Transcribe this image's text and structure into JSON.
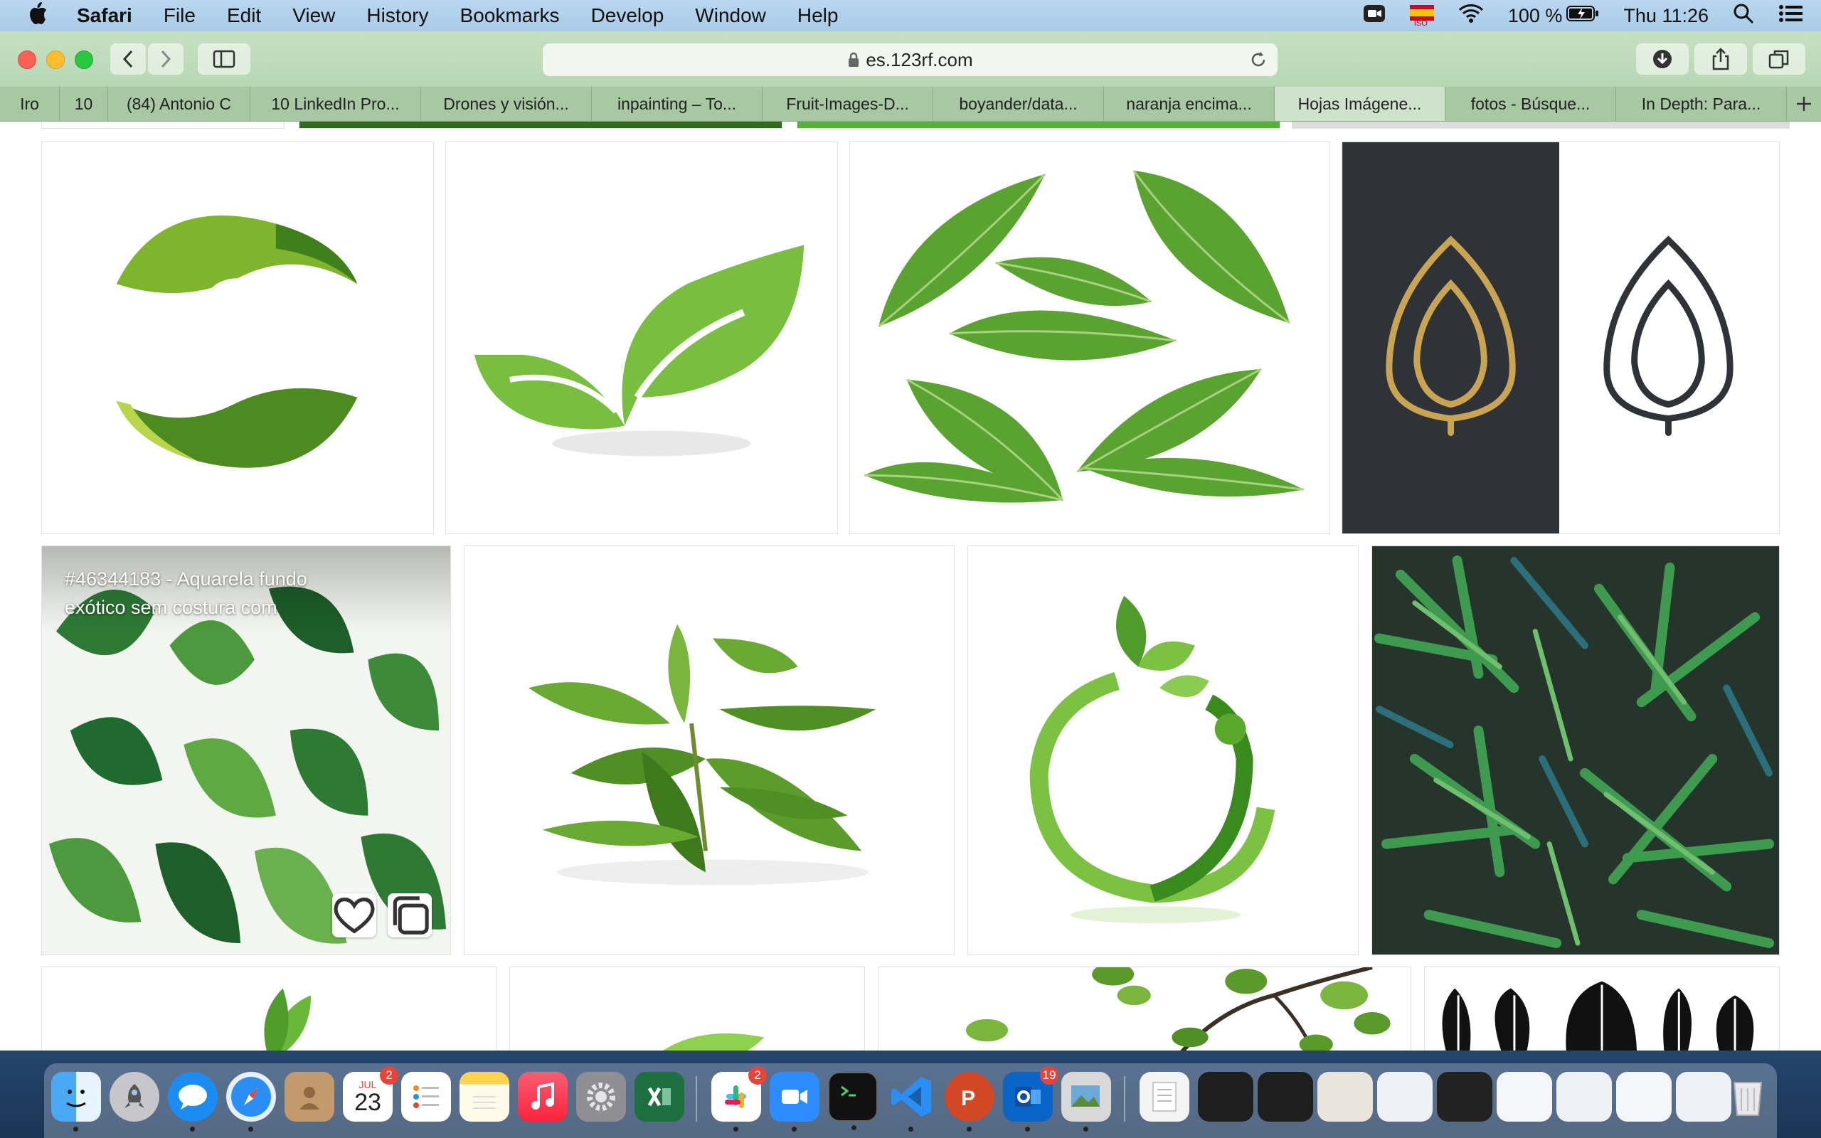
{
  "menubar": {
    "app_name": "Safari",
    "menus": [
      "File",
      "Edit",
      "View",
      "History",
      "Bookmarks",
      "Develop",
      "Window",
      "Help"
    ],
    "battery_text": "100 %",
    "clock": "Thu 11:26",
    "input_source": "ISO"
  },
  "toolbar": {
    "url": "es.123rf.com"
  },
  "tabs": [
    "Iro",
    "10",
    "(84) Antonio C",
    "10 LinkedIn Pro...",
    "Drones y visión...",
    "inpainting – To...",
    "Fruit-Images-D...",
    "boyander/data...",
    "naranja encima...",
    "Hojas Imágene...",
    "fotos - Búsque...",
    "In Depth: Para..."
  ],
  "active_tab_index": 9,
  "gallery": {
    "hover_caption_line1": "#46344183 - Aquarela fundo",
    "hover_caption_line2": "exótico sem costura com",
    "images": [
      "two-leaves-logo",
      "sprout-logo",
      "green-leaves-photo",
      "golden-leaf-logo",
      "tropical-watercolor-pattern",
      "tea-leaves-photo",
      "circle-leaf-person-logo",
      "palm-leaves-pattern"
    ]
  },
  "dock": {
    "calendar_month": "JUL",
    "calendar_day": "23",
    "calendar_badge": "2",
    "slack_badge": "2",
    "outlook_badge": "19"
  },
  "colors": {
    "menubar": "#b9d6ee",
    "toolbar": "#c6e0c1",
    "tabbar": "#a8c7a3",
    "leaf_green": "#6db33f",
    "dark_panel": "#2f3338",
    "gold": "#c9a453"
  }
}
